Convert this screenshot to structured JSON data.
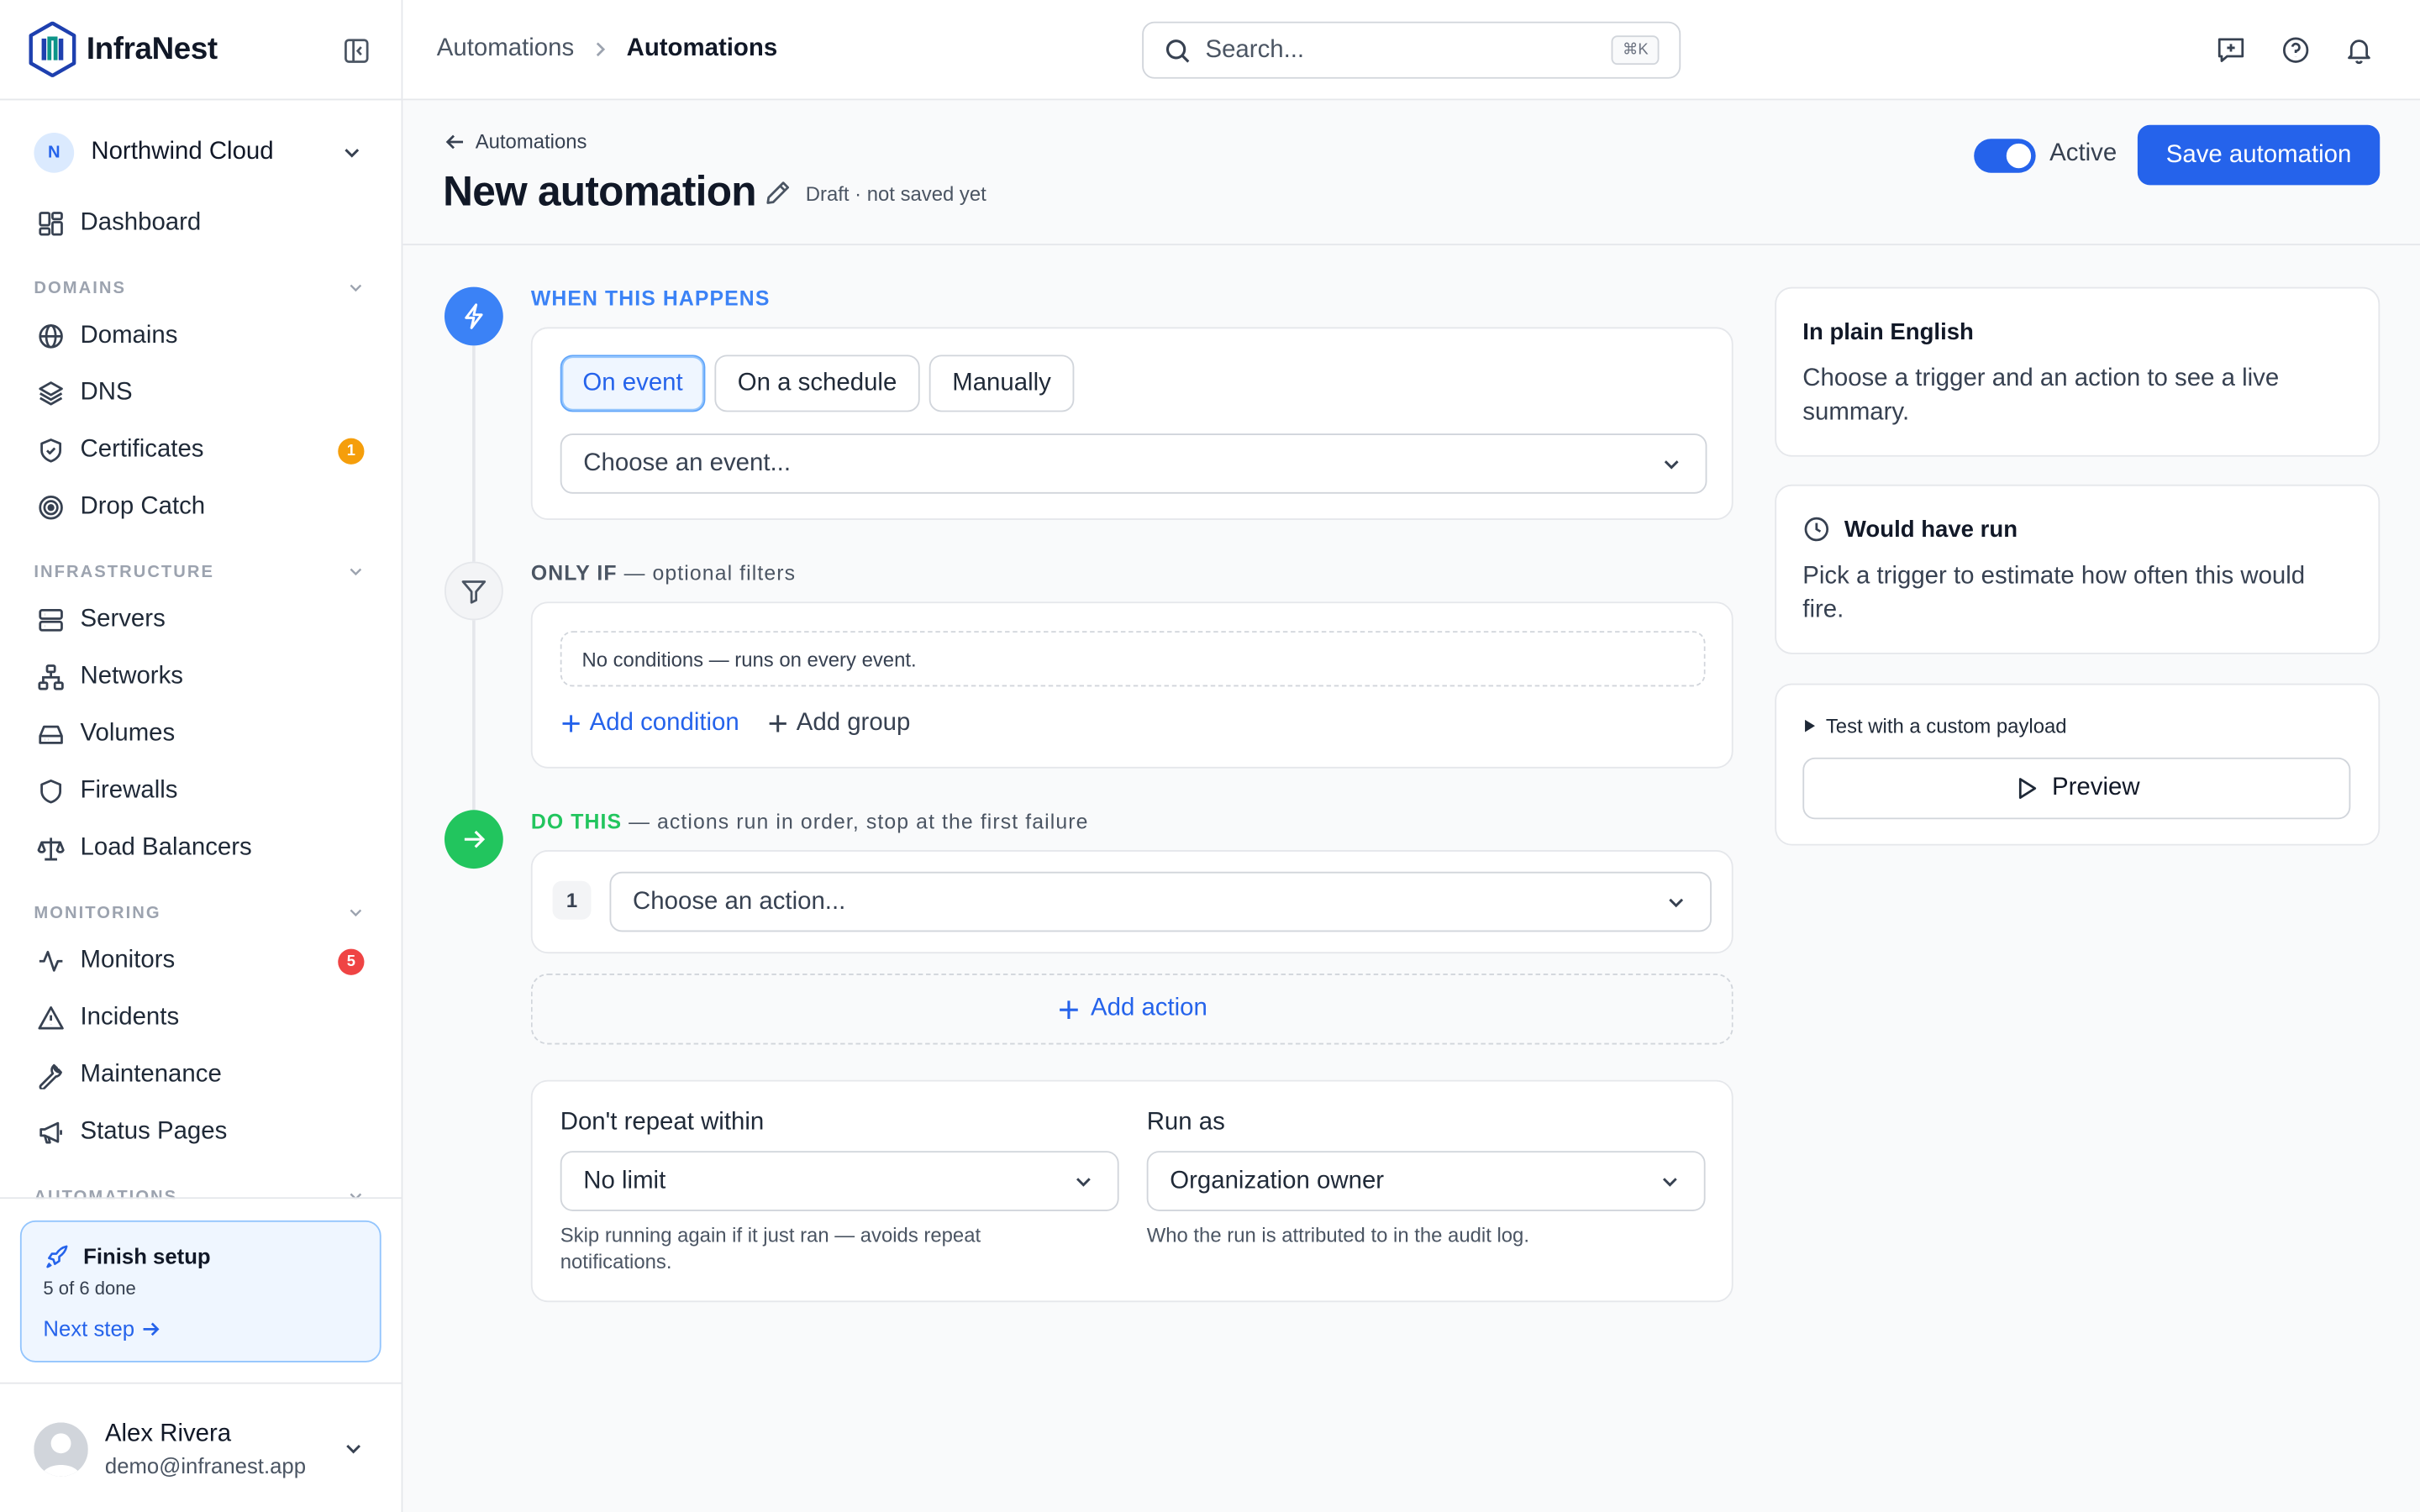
{
  "brand": {
    "name": "InfraNest"
  },
  "org": {
    "initial": "N",
    "name": "Northwind Cloud"
  },
  "sidebar": {
    "top_items": [
      {
        "label": "Dashboard",
        "icon": "dashboard-icon"
      }
    ],
    "sections": [
      {
        "title": "DOMAINS",
        "items": [
          {
            "label": "Domains",
            "icon": "globe-icon"
          },
          {
            "label": "DNS",
            "icon": "layers-icon"
          },
          {
            "label": "Certificates",
            "icon": "shield-check-icon",
            "badge": "1",
            "badge_color": "#f59e0b"
          },
          {
            "label": "Drop Catch",
            "icon": "target-icon"
          }
        ]
      },
      {
        "title": "INFRASTRUCTURE",
        "items": [
          {
            "label": "Servers",
            "icon": "server-icon"
          },
          {
            "label": "Networks",
            "icon": "network-icon"
          },
          {
            "label": "Volumes",
            "icon": "hard-drive-icon"
          },
          {
            "label": "Firewalls",
            "icon": "shield-icon"
          },
          {
            "label": "Load Balancers",
            "icon": "scale-icon"
          }
        ]
      },
      {
        "title": "MONITORING",
        "items": [
          {
            "label": "Monitors",
            "icon": "activity-icon",
            "badge": "5",
            "badge_color": "#ef4444"
          },
          {
            "label": "Incidents",
            "icon": "alert-triangle-icon"
          },
          {
            "label": "Maintenance",
            "icon": "wrench-icon"
          },
          {
            "label": "Status Pages",
            "icon": "megaphone-icon"
          }
        ]
      },
      {
        "title": "AUTOMATIONS",
        "items": []
      }
    ]
  },
  "setup": {
    "title": "Finish setup",
    "progress": "5 of 6 done",
    "next": "Next step"
  },
  "user": {
    "name": "Alex Rivera",
    "email": "demo@infranest.app"
  },
  "topbar": {
    "breadcrumb": [
      "Automations",
      "Automations"
    ],
    "search_placeholder": "Search...",
    "search_shortcut": "⌘K",
    "icons": [
      "feedback-icon",
      "help-icon",
      "bell-icon"
    ]
  },
  "page": {
    "back_label": "Automations",
    "title": "New automation",
    "status": "Draft · not saved yet",
    "active_label": "Active",
    "active": true,
    "save_label": "Save automation"
  },
  "trigger": {
    "heading": "WHEN THIS HAPPENS",
    "modes": [
      "On event",
      "On a schedule",
      "Manually"
    ],
    "selected_mode": "On event",
    "event_placeholder": "Choose an event..."
  },
  "filters": {
    "heading_bold": "ONLY IF",
    "heading_rest": " — optional filters",
    "empty_text": "No conditions — runs on every event.",
    "add_condition": "Add condition",
    "add_group": "Add group"
  },
  "actions": {
    "heading_bold": "DO THIS",
    "heading_rest": " — actions run in order, stop at the first failure",
    "step_number": "1",
    "action_placeholder": "Choose an action...",
    "add_action": "Add action"
  },
  "options": {
    "repeat_label": "Don't repeat within",
    "repeat_value": "No limit",
    "repeat_help": "Skip running again if it just ran — avoids repeat notifications.",
    "runas_label": "Run as",
    "runas_value": "Organization owner",
    "runas_help": "Who the run is attributed to in the audit log."
  },
  "summary": {
    "title": "In plain English",
    "body": "Choose a trigger and an action to see a live summary."
  },
  "estimate": {
    "title": "Would have run",
    "body": "Pick a trigger to estimate how often this would fire."
  },
  "test": {
    "toggle_label": "Test with a custom payload",
    "preview_label": "Preview"
  },
  "colors": {
    "accent": "#2563eb",
    "success": "#22c55e",
    "warning": "#f59e0b",
    "danger": "#ef4444"
  }
}
